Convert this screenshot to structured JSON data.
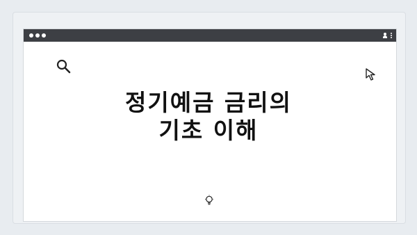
{
  "headline": {
    "line1": "정기예금 금리의",
    "line2": "기초 이해"
  },
  "icons": {
    "top_dots": "pagination-dots-icon",
    "traffic_lights": "window-controls-icon",
    "user": "user-icon",
    "menu": "kebab-menu-icon",
    "search": "search-icon",
    "cursor": "cursor-arrow-icon",
    "bulb": "lightbulb-icon"
  },
  "colors": {
    "background": "#e8ecf0",
    "titlebar": "#3d3f44",
    "content": "#ffffff",
    "text": "#111111"
  }
}
